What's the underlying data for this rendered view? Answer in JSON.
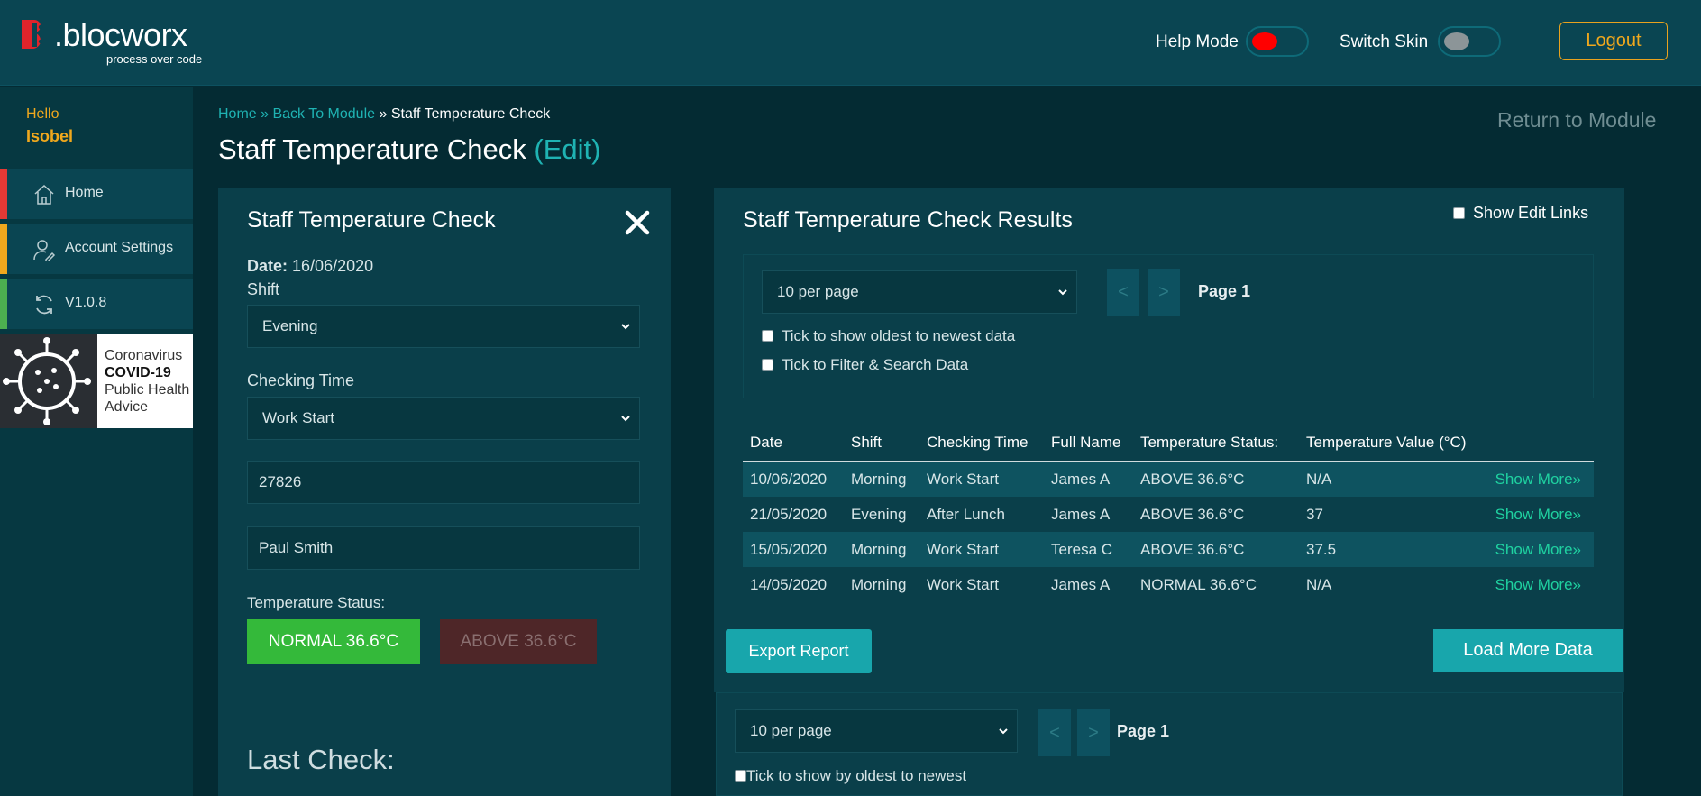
{
  "brand": {
    "name": ".blocworx",
    "tagline": "process over code"
  },
  "header": {
    "help_mode_label": "Help Mode",
    "switch_skin_label": "Switch Skin",
    "logout_label": "Logout"
  },
  "colors": {
    "accent": "#1fb3b3",
    "orange": "#f0a81d",
    "help_knob": "#ff0000",
    "normal": "#34b93a",
    "above": "#4e2628"
  },
  "sidebar": {
    "hello": "Hello",
    "user_name": "Isobel",
    "items": [
      {
        "label": "Home",
        "icon": "home-icon",
        "color": "#e53935"
      },
      {
        "label": "Account Settings",
        "icon": "user-settings-icon",
        "color": "#f0a81d"
      },
      {
        "label": "V1.0.8",
        "icon": "refresh-icon",
        "color": "#4caf50"
      }
    ],
    "covid": {
      "line1": "Coronavirus",
      "line2": "COVID-19",
      "line3": "Public Health",
      "line4": "Advice"
    }
  },
  "breadcrumb": {
    "home": "Home",
    "sep1": " » ",
    "back": "Back To Module",
    "sep2": " » ",
    "current": "Staff Temperature Check"
  },
  "page": {
    "title": "Staff Temperature Check",
    "edit": "(Edit)",
    "return_link": "Return to Module"
  },
  "form": {
    "title": "Staff Temperature Check",
    "date_label": "Date:",
    "date_value": "16/06/2020",
    "shift_label": "Shift",
    "shift_value": "Evening",
    "checking_time_label": "Checking Time",
    "checking_time_value": "Work Start",
    "id_value": "27826",
    "name_value": "Paul Smith",
    "temp_status_label": "Temperature Status:",
    "normal_btn": "NORMAL 36.6°C",
    "above_btn": "ABOVE 36.6°C",
    "last_check_label": "Last Check:"
  },
  "results": {
    "title": "Staff Temperature Check Results",
    "show_edit_links": "Show Edit Links",
    "per_page": "10 per page",
    "prev": "<",
    "next": ">",
    "page_label": "Page 1",
    "tick_oldest": "Tick to show oldest to newest data",
    "tick_filter": "Tick to Filter & Search Data",
    "columns": [
      "Date",
      "Shift",
      "Checking Time",
      "Full Name",
      "Temperature Status:",
      "Temperature Value (°C)",
      ""
    ],
    "rows": [
      {
        "date": "10/06/2020",
        "shift": "Morning",
        "time": "Work Start",
        "name": "James A",
        "status": "ABOVE 36.6°C",
        "value": "N/A",
        "more": "Show More»"
      },
      {
        "date": "21/05/2020",
        "shift": "Evening",
        "time": "After Lunch",
        "name": "James A",
        "status": "ABOVE 36.6°C",
        "value": "37",
        "more": "Show More»"
      },
      {
        "date": "15/05/2020",
        "shift": "Morning",
        "time": "Work Start",
        "name": "Teresa C",
        "status": "ABOVE 36.6°C",
        "value": "37.5",
        "more": "Show More»"
      },
      {
        "date": "14/05/2020",
        "shift": "Morning",
        "time": "Work Start",
        "name": "James A",
        "status": "NORMAL 36.6°C",
        "value": "N/A",
        "more": "Show More»"
      }
    ],
    "export_btn": "Export Report",
    "load_more_btn": "Load More Data",
    "bottom_per_page": "10 per page",
    "bottom_page_label": "Page 1",
    "bottom_tick": "Tick to show by oldest to newest"
  }
}
